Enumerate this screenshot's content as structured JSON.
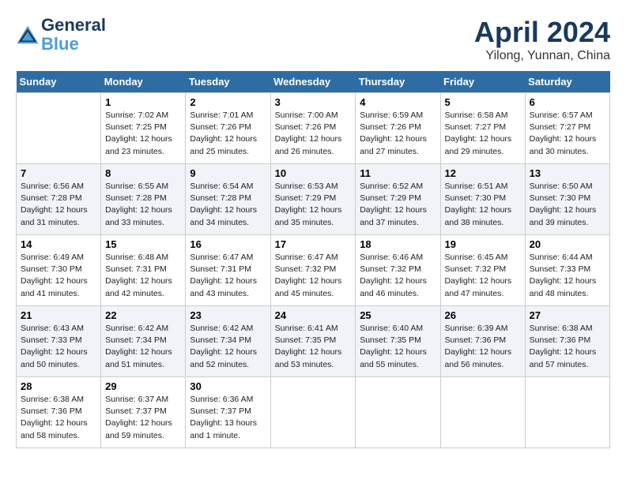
{
  "header": {
    "logo_line1": "General",
    "logo_line2": "Blue",
    "month": "April 2024",
    "location": "Yilong, Yunnan, China"
  },
  "weekdays": [
    "Sunday",
    "Monday",
    "Tuesday",
    "Wednesday",
    "Thursday",
    "Friday",
    "Saturday"
  ],
  "weeks": [
    [
      {
        "day": "",
        "info": ""
      },
      {
        "day": "1",
        "info": "Sunrise: 7:02 AM\nSunset: 7:25 PM\nDaylight: 12 hours\nand 23 minutes."
      },
      {
        "day": "2",
        "info": "Sunrise: 7:01 AM\nSunset: 7:26 PM\nDaylight: 12 hours\nand 25 minutes."
      },
      {
        "day": "3",
        "info": "Sunrise: 7:00 AM\nSunset: 7:26 PM\nDaylight: 12 hours\nand 26 minutes."
      },
      {
        "day": "4",
        "info": "Sunrise: 6:59 AM\nSunset: 7:26 PM\nDaylight: 12 hours\nand 27 minutes."
      },
      {
        "day": "5",
        "info": "Sunrise: 6:58 AM\nSunset: 7:27 PM\nDaylight: 12 hours\nand 29 minutes."
      },
      {
        "day": "6",
        "info": "Sunrise: 6:57 AM\nSunset: 7:27 PM\nDaylight: 12 hours\nand 30 minutes."
      }
    ],
    [
      {
        "day": "7",
        "info": "Sunrise: 6:56 AM\nSunset: 7:28 PM\nDaylight: 12 hours\nand 31 minutes."
      },
      {
        "day": "8",
        "info": "Sunrise: 6:55 AM\nSunset: 7:28 PM\nDaylight: 12 hours\nand 33 minutes."
      },
      {
        "day": "9",
        "info": "Sunrise: 6:54 AM\nSunset: 7:28 PM\nDaylight: 12 hours\nand 34 minutes."
      },
      {
        "day": "10",
        "info": "Sunrise: 6:53 AM\nSunset: 7:29 PM\nDaylight: 12 hours\nand 35 minutes."
      },
      {
        "day": "11",
        "info": "Sunrise: 6:52 AM\nSunset: 7:29 PM\nDaylight: 12 hours\nand 37 minutes."
      },
      {
        "day": "12",
        "info": "Sunrise: 6:51 AM\nSunset: 7:30 PM\nDaylight: 12 hours\nand 38 minutes."
      },
      {
        "day": "13",
        "info": "Sunrise: 6:50 AM\nSunset: 7:30 PM\nDaylight: 12 hours\nand 39 minutes."
      }
    ],
    [
      {
        "day": "14",
        "info": "Sunrise: 6:49 AM\nSunset: 7:30 PM\nDaylight: 12 hours\nand 41 minutes."
      },
      {
        "day": "15",
        "info": "Sunrise: 6:48 AM\nSunset: 7:31 PM\nDaylight: 12 hours\nand 42 minutes."
      },
      {
        "day": "16",
        "info": "Sunrise: 6:47 AM\nSunset: 7:31 PM\nDaylight: 12 hours\nand 43 minutes."
      },
      {
        "day": "17",
        "info": "Sunrise: 6:47 AM\nSunset: 7:32 PM\nDaylight: 12 hours\nand 45 minutes."
      },
      {
        "day": "18",
        "info": "Sunrise: 6:46 AM\nSunset: 7:32 PM\nDaylight: 12 hours\nand 46 minutes."
      },
      {
        "day": "19",
        "info": "Sunrise: 6:45 AM\nSunset: 7:32 PM\nDaylight: 12 hours\nand 47 minutes."
      },
      {
        "day": "20",
        "info": "Sunrise: 6:44 AM\nSunset: 7:33 PM\nDaylight: 12 hours\nand 48 minutes."
      }
    ],
    [
      {
        "day": "21",
        "info": "Sunrise: 6:43 AM\nSunset: 7:33 PM\nDaylight: 12 hours\nand 50 minutes."
      },
      {
        "day": "22",
        "info": "Sunrise: 6:42 AM\nSunset: 7:34 PM\nDaylight: 12 hours\nand 51 minutes."
      },
      {
        "day": "23",
        "info": "Sunrise: 6:42 AM\nSunset: 7:34 PM\nDaylight: 12 hours\nand 52 minutes."
      },
      {
        "day": "24",
        "info": "Sunrise: 6:41 AM\nSunset: 7:35 PM\nDaylight: 12 hours\nand 53 minutes."
      },
      {
        "day": "25",
        "info": "Sunrise: 6:40 AM\nSunset: 7:35 PM\nDaylight: 12 hours\nand 55 minutes."
      },
      {
        "day": "26",
        "info": "Sunrise: 6:39 AM\nSunset: 7:36 PM\nDaylight: 12 hours\nand 56 minutes."
      },
      {
        "day": "27",
        "info": "Sunrise: 6:38 AM\nSunset: 7:36 PM\nDaylight: 12 hours\nand 57 minutes."
      }
    ],
    [
      {
        "day": "28",
        "info": "Sunrise: 6:38 AM\nSunset: 7:36 PM\nDaylight: 12 hours\nand 58 minutes."
      },
      {
        "day": "29",
        "info": "Sunrise: 6:37 AM\nSunset: 7:37 PM\nDaylight: 12 hours\nand 59 minutes."
      },
      {
        "day": "30",
        "info": "Sunrise: 6:36 AM\nSunset: 7:37 PM\nDaylight: 13 hours\nand 1 minute."
      },
      {
        "day": "",
        "info": ""
      },
      {
        "day": "",
        "info": ""
      },
      {
        "day": "",
        "info": ""
      },
      {
        "day": "",
        "info": ""
      }
    ]
  ]
}
